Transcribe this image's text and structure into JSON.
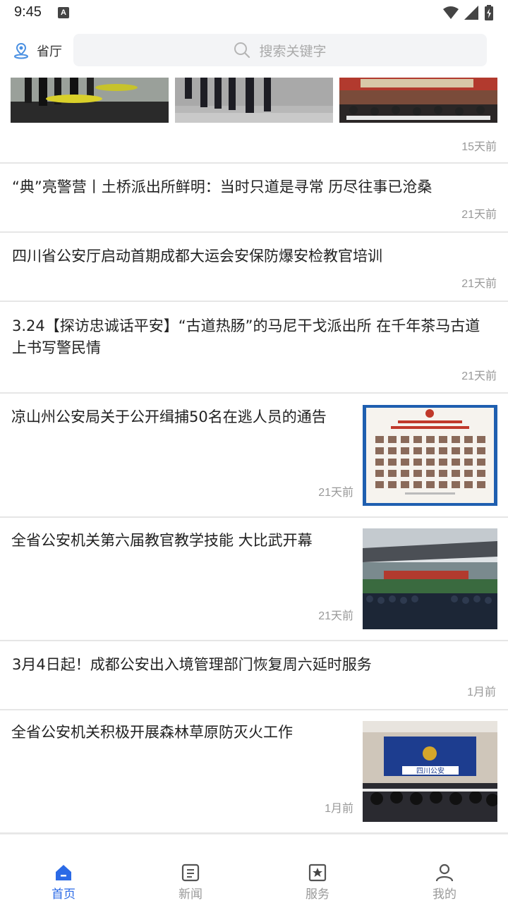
{
  "status": {
    "time": "9:45",
    "notif_icon": "A"
  },
  "header": {
    "location": "省厅",
    "search_placeholder": "搜索关键字"
  },
  "feed": {
    "first_item_time": "15天前",
    "items": [
      {
        "title": "“典”亮警营丨土桥派出所鲜明：当时只道是寻常 历尽往事已沧桑",
        "time": "21天前"
      },
      {
        "title": "四川省公安厅启动首期成都大运会安保防爆安检教官培训",
        "time": "21天前"
      },
      {
        "title": "3.24【探访忠诚话平安】“古道热肠”的马尼干戈派出所 在千年茶马古道上书写警民情",
        "time": "21天前"
      },
      {
        "title": "凉山州公安局关于公开缉捕50名在逃人员的通告",
        "time": "21天前"
      },
      {
        "title": "全省公安机关第六届教官教学技能 大比武开幕",
        "time": "21天前"
      },
      {
        "title": "3月4日起！成都公安出入境管理部门恢复周六延时服务",
        "time": "1月前"
      },
      {
        "title": "全省公安机关积极开展森林草原防灭火工作",
        "time": "1月前"
      }
    ],
    "poster_banner": "四川公安"
  },
  "nav": [
    {
      "label": "首页",
      "active": true
    },
    {
      "label": "新闻",
      "active": false
    },
    {
      "label": "服务",
      "active": false
    },
    {
      "label": "我的",
      "active": false
    }
  ],
  "colors": {
    "accent": "#2b6ae6",
    "muted": "#999999",
    "divider": "#e6e6e6"
  }
}
